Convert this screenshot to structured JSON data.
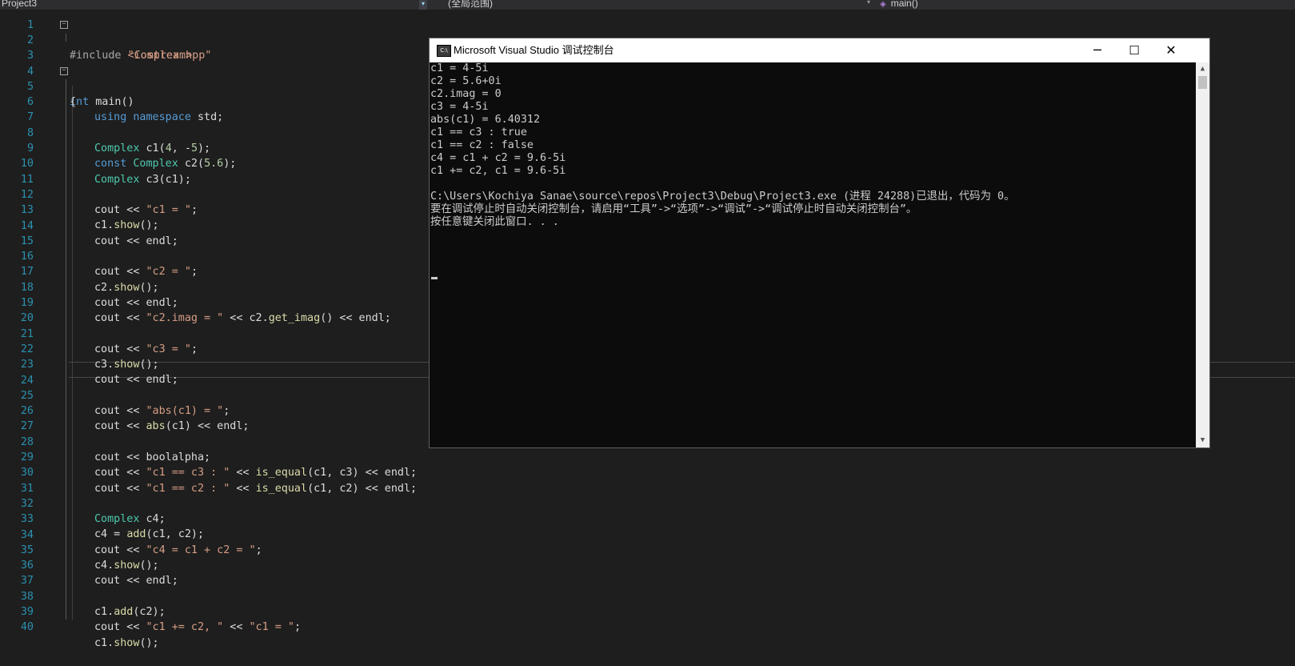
{
  "navbar": {
    "project": "Project3",
    "scope": "(全局范围)",
    "function": "main()"
  },
  "code_lines": [
    {
      "n": "1"
    },
    {
      "n": "2"
    },
    {
      "n": "3"
    },
    {
      "n": "4"
    },
    {
      "n": "5"
    },
    {
      "n": "6"
    },
    {
      "n": "7"
    },
    {
      "n": "8"
    },
    {
      "n": "9"
    },
    {
      "n": "10"
    },
    {
      "n": "11"
    },
    {
      "n": "12"
    },
    {
      "n": "13"
    },
    {
      "n": "14"
    },
    {
      "n": "15"
    },
    {
      "n": "16"
    },
    {
      "n": "17"
    },
    {
      "n": "18"
    },
    {
      "n": "19"
    },
    {
      "n": "20"
    },
    {
      "n": "21"
    },
    {
      "n": "22"
    },
    {
      "n": "23"
    },
    {
      "n": "24"
    },
    {
      "n": "25"
    },
    {
      "n": "26"
    },
    {
      "n": "27"
    },
    {
      "n": "28"
    },
    {
      "n": "29"
    },
    {
      "n": "30"
    },
    {
      "n": "31"
    },
    {
      "n": "32"
    },
    {
      "n": "33"
    },
    {
      "n": "34"
    },
    {
      "n": "35"
    },
    {
      "n": "36"
    },
    {
      "n": "37"
    },
    {
      "n": "38"
    },
    {
      "n": "39"
    },
    {
      "n": "40"
    }
  ],
  "code": {
    "l1": {
      "a": "#include ",
      "b": "\"Complex.hpp\""
    },
    "l2": {
      "a": "#include ",
      "b": "<iostream>"
    },
    "l4": {
      "a": "int",
      "b": " main()"
    },
    "l5": "{",
    "l6": {
      "a": "using namespace",
      "b": " std;"
    },
    "l8": {
      "a": "Complex",
      "b": " c1(",
      "c": "4",
      "d": ", -",
      "e": "5",
      "f": ");"
    },
    "l9": {
      "a": "const",
      "b": " ",
      "c": "Complex",
      "d": " c2(",
      "e": "5.6",
      "f": ");"
    },
    "l10": {
      "a": "Complex",
      "b": " c3(c1);"
    },
    "l12": {
      "a": "cout << ",
      "b": "\"c1 = \"",
      "c": ";"
    },
    "l13": {
      "a": "c1.",
      "b": "show",
      "c": "();"
    },
    "l14": "cout << endl;",
    "l16": {
      "a": "cout << ",
      "b": "\"c2 = \"",
      "c": ";"
    },
    "l17": {
      "a": "c2.",
      "b": "show",
      "c": "();"
    },
    "l18": "cout << endl;",
    "l19": {
      "a": "cout << ",
      "b": "\"c2.imag = \"",
      "c": " << c2.",
      "d": "get_imag",
      "e": "() << endl;"
    },
    "l21": {
      "a": "cout << ",
      "b": "\"c3 = \"",
      "c": ";"
    },
    "l22": {
      "a": "c3.",
      "b": "show",
      "c": "();"
    },
    "l23": "cout << endl;",
    "l25": {
      "a": "cout << ",
      "b": "\"abs(c1) = \"",
      "c": ";"
    },
    "l26": {
      "a": "cout << ",
      "b": "abs",
      "c": "(c1) << endl;"
    },
    "l28": "cout << boolalpha;",
    "l29": {
      "a": "cout << ",
      "b": "\"c1 == c3 : \"",
      "c": " << ",
      "d": "is_equal",
      "e": "(c1, c3) << endl;"
    },
    "l30": {
      "a": "cout << ",
      "b": "\"c1 == c2 : \"",
      "c": " << ",
      "d": "is_equal",
      "e": "(c1, c2) << endl;"
    },
    "l32": {
      "a": "Complex",
      "b": " c4;"
    },
    "l33": {
      "a": "c4 = ",
      "b": "add",
      "c": "(c1, c2);"
    },
    "l34": {
      "a": "cout << ",
      "b": "\"c4 = c1 + c2 = \"",
      "c": ";"
    },
    "l35": {
      "a": "c4.",
      "b": "show",
      "c": "();"
    },
    "l36": "cout << endl;",
    "l38": {
      "a": "c1.",
      "b": "add",
      "c": "(c2);"
    },
    "l39": {
      "a": "cout << ",
      "b": "\"c1 += c2, \"",
      "c": " << ",
      "d": "\"c1 = \"",
      "e": ";"
    },
    "l40": {
      "a": "c1.",
      "b": "show",
      "c": "();"
    }
  },
  "console": {
    "title": "Microsoft Visual Studio 调试控制台",
    "icon_label": "C:\\",
    "buttons": {
      "minimize": "─",
      "maximize": "☐",
      "close": "✕"
    },
    "lines": [
      "c1 = 4-5i",
      "c2 = 5.6+0i",
      "c2.imag = 0",
      "c3 = 4-5i",
      "abs(c1) = 6.40312",
      "c1 == c3 : true",
      "c1 == c2 : false",
      "c4 = c1 + c2 = 9.6-5i",
      "c1 += c2, c1 = 9.6-5i",
      "",
      "C:\\Users\\Kochiya Sanae\\source\\repos\\Project3\\Debug\\Project3.exe (进程 24288)已退出，代码为 0。",
      "要在调试停止时自动关闭控制台，请启用“工具”->“选项”->“调试”->“调试停止时自动关闭控制台”。",
      "按任意键关闭此窗口. . ."
    ]
  }
}
